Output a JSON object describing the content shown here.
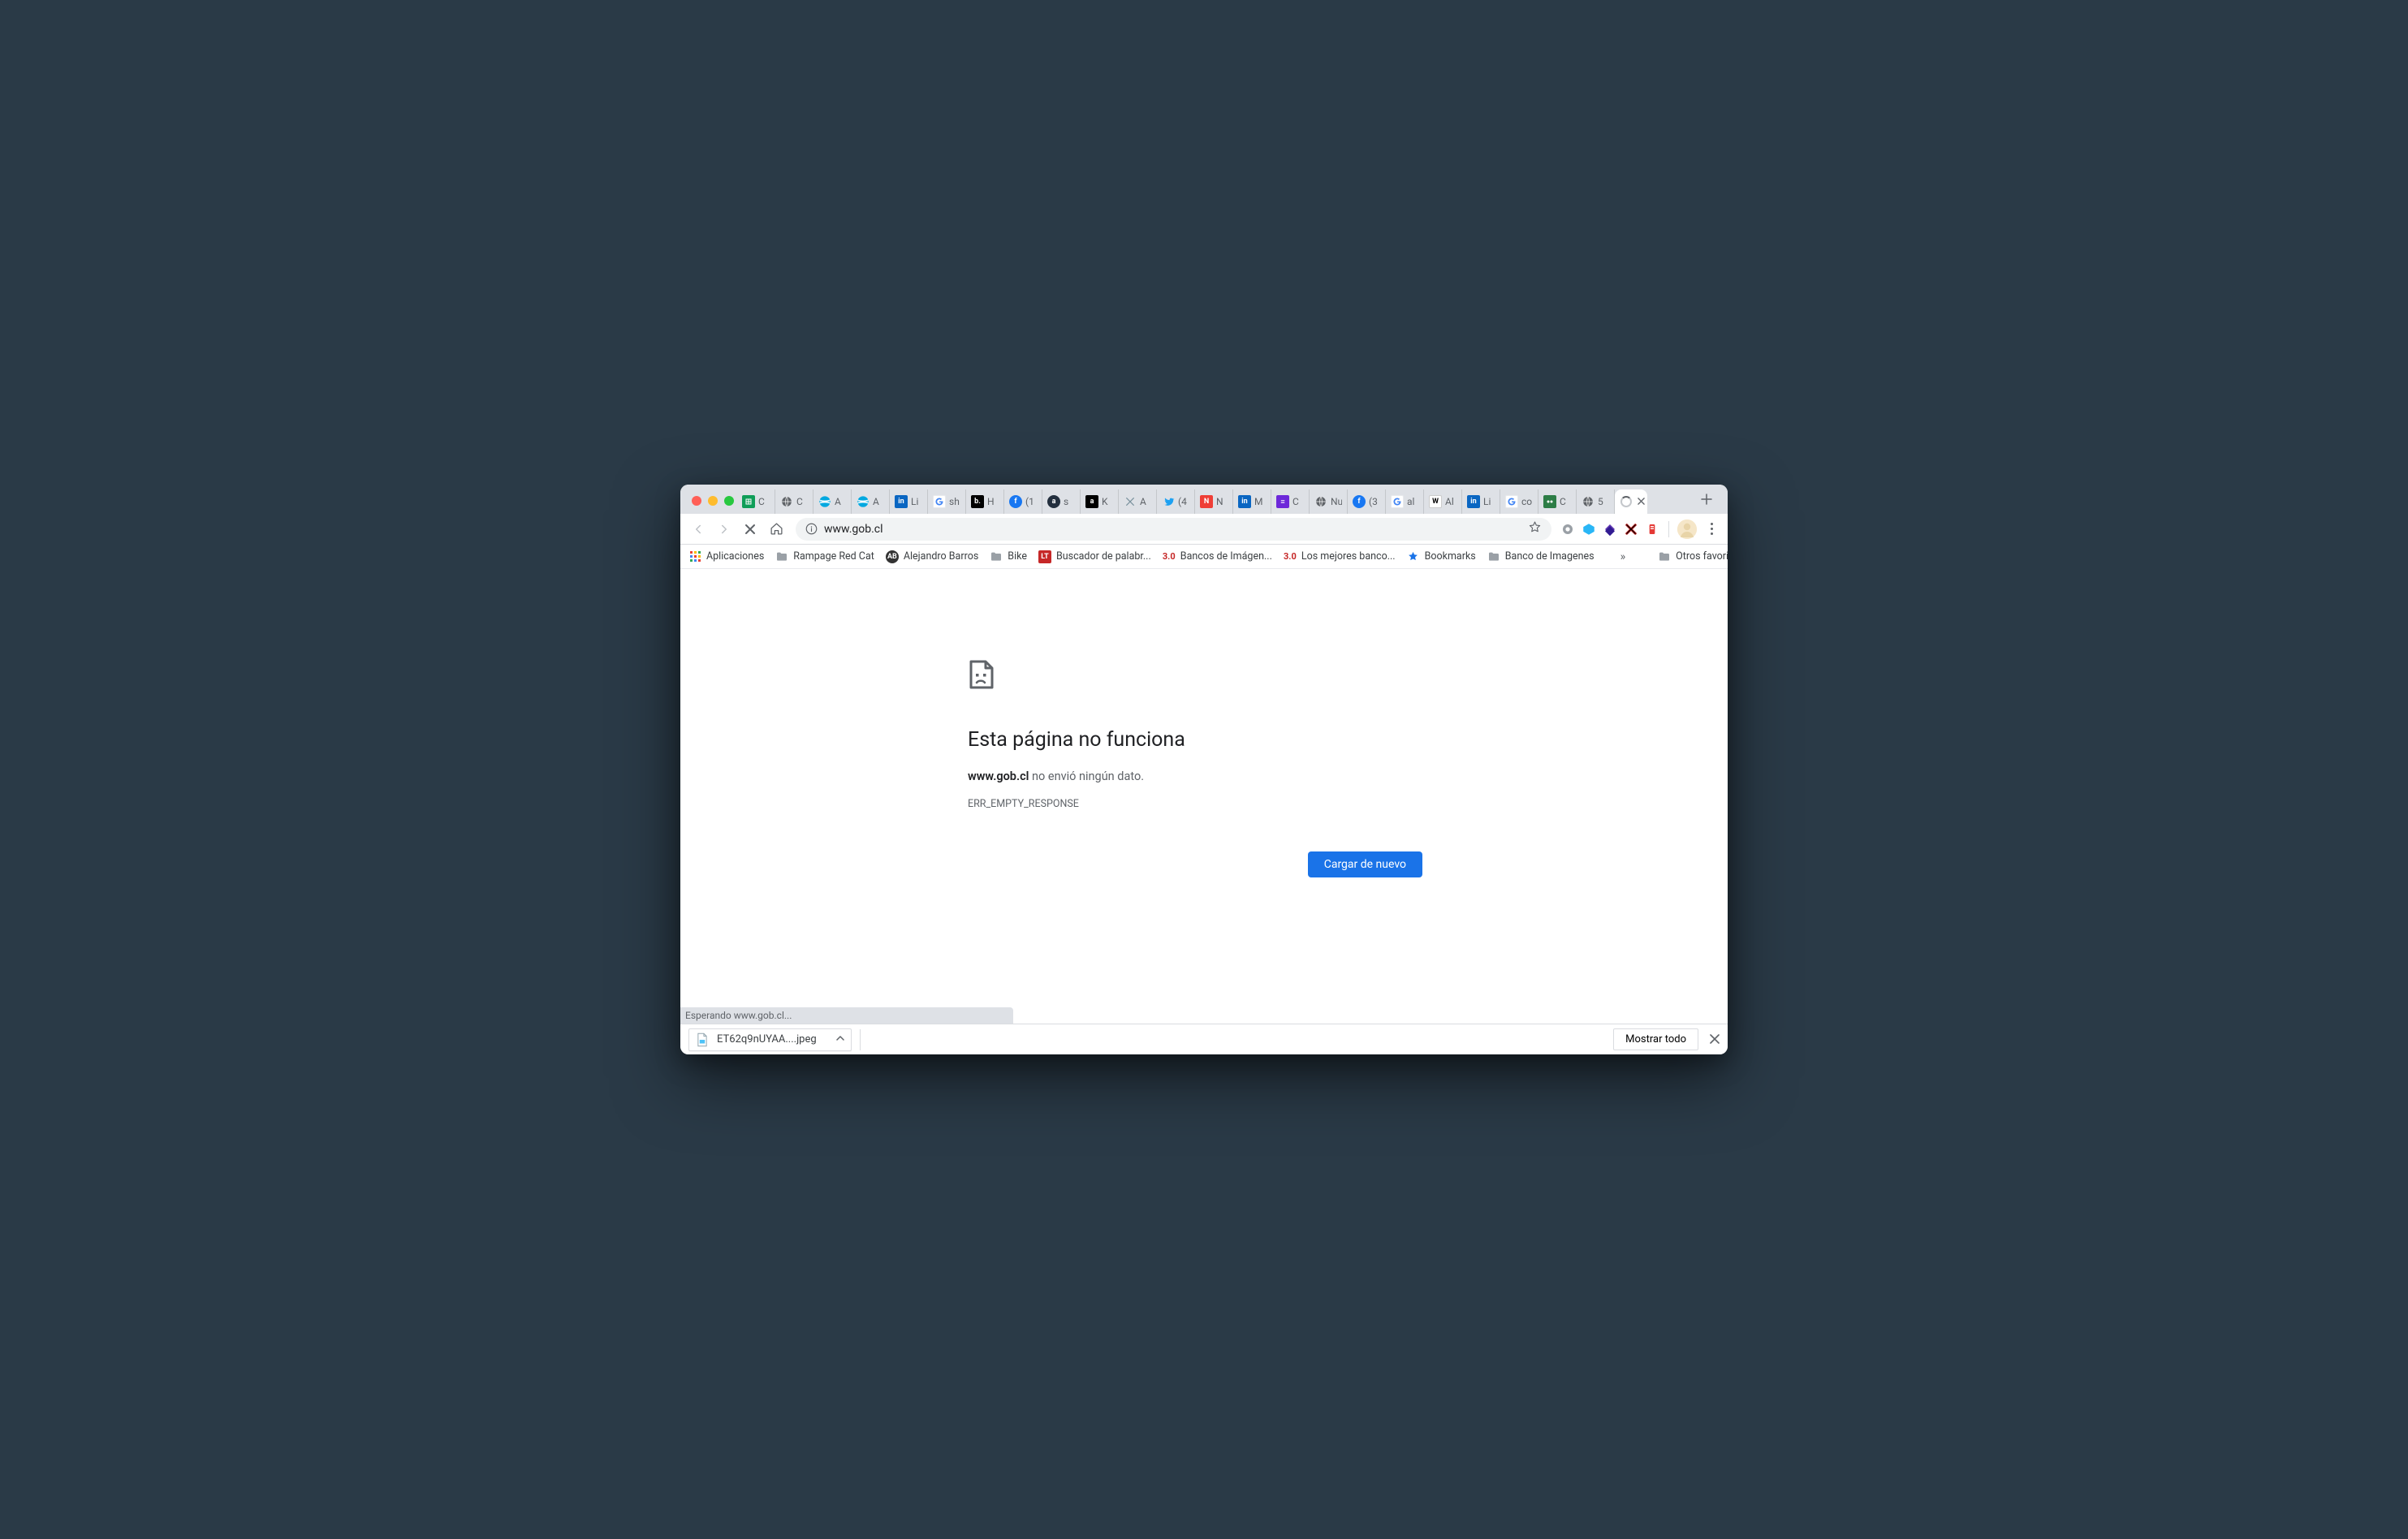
{
  "tabs": [
    {
      "icon": "sheet",
      "label": "C"
    },
    {
      "icon": "globe",
      "label": "C"
    },
    {
      "icon": "att",
      "label": "A"
    },
    {
      "icon": "att",
      "label": "A"
    },
    {
      "icon": "li",
      "label": "Li"
    },
    {
      "icon": "g",
      "label": "sh"
    },
    {
      "icon": "b",
      "label": "H"
    },
    {
      "icon": "fb",
      "label": "(1"
    },
    {
      "icon": "amz",
      "label": "s"
    },
    {
      "icon": "kw",
      "label": "K"
    },
    {
      "icon": "px",
      "label": "A"
    },
    {
      "icon": "tw",
      "label": "(4"
    },
    {
      "icon": "nz",
      "label": "N"
    },
    {
      "icon": "li",
      "label": "M"
    },
    {
      "icon": "lf",
      "label": "C"
    },
    {
      "icon": "none",
      "label": "Nueva"
    },
    {
      "icon": "fb",
      "label": "(3"
    },
    {
      "icon": "g",
      "label": "al"
    },
    {
      "icon": "wiki",
      "label": "Al"
    },
    {
      "icon": "li",
      "label": "Li"
    },
    {
      "icon": "g",
      "label": "co"
    },
    {
      "icon": "ct",
      "label": "C"
    },
    {
      "icon": "globe",
      "label": "5"
    }
  ],
  "activeTab": {
    "label": ""
  },
  "toolbar": {
    "url": "www.gob.cl"
  },
  "bookmarks_bar": {
    "apps": "Aplicaciones",
    "items": [
      {
        "icon": "folder",
        "label": "Rampage Red Cat"
      },
      {
        "icon": "ab",
        "label": "Alejandro Barros"
      },
      {
        "icon": "folder",
        "label": "Bike"
      },
      {
        "icon": "lt",
        "label": "Buscador de palabr..."
      },
      {
        "icon": "30",
        "label": "Bancos de Imágen..."
      },
      {
        "icon": "30",
        "label": "Los mejores banco..."
      },
      {
        "icon": "star",
        "label": "Bookmarks"
      },
      {
        "icon": "folder",
        "label": "Banco de Imagenes"
      }
    ],
    "other": "Otros favoritos"
  },
  "error": {
    "title": "Esta página no funciona",
    "host": "www.gob.cl",
    "message": " no envió ningún dato.",
    "code": "ERR_EMPTY_RESPONSE",
    "reload": "Cargar de nuevo"
  },
  "status": "Esperando www.gob.cl...",
  "downloads": {
    "file": "ET62q9nUYAA....jpeg",
    "show_all": "Mostrar todo"
  }
}
